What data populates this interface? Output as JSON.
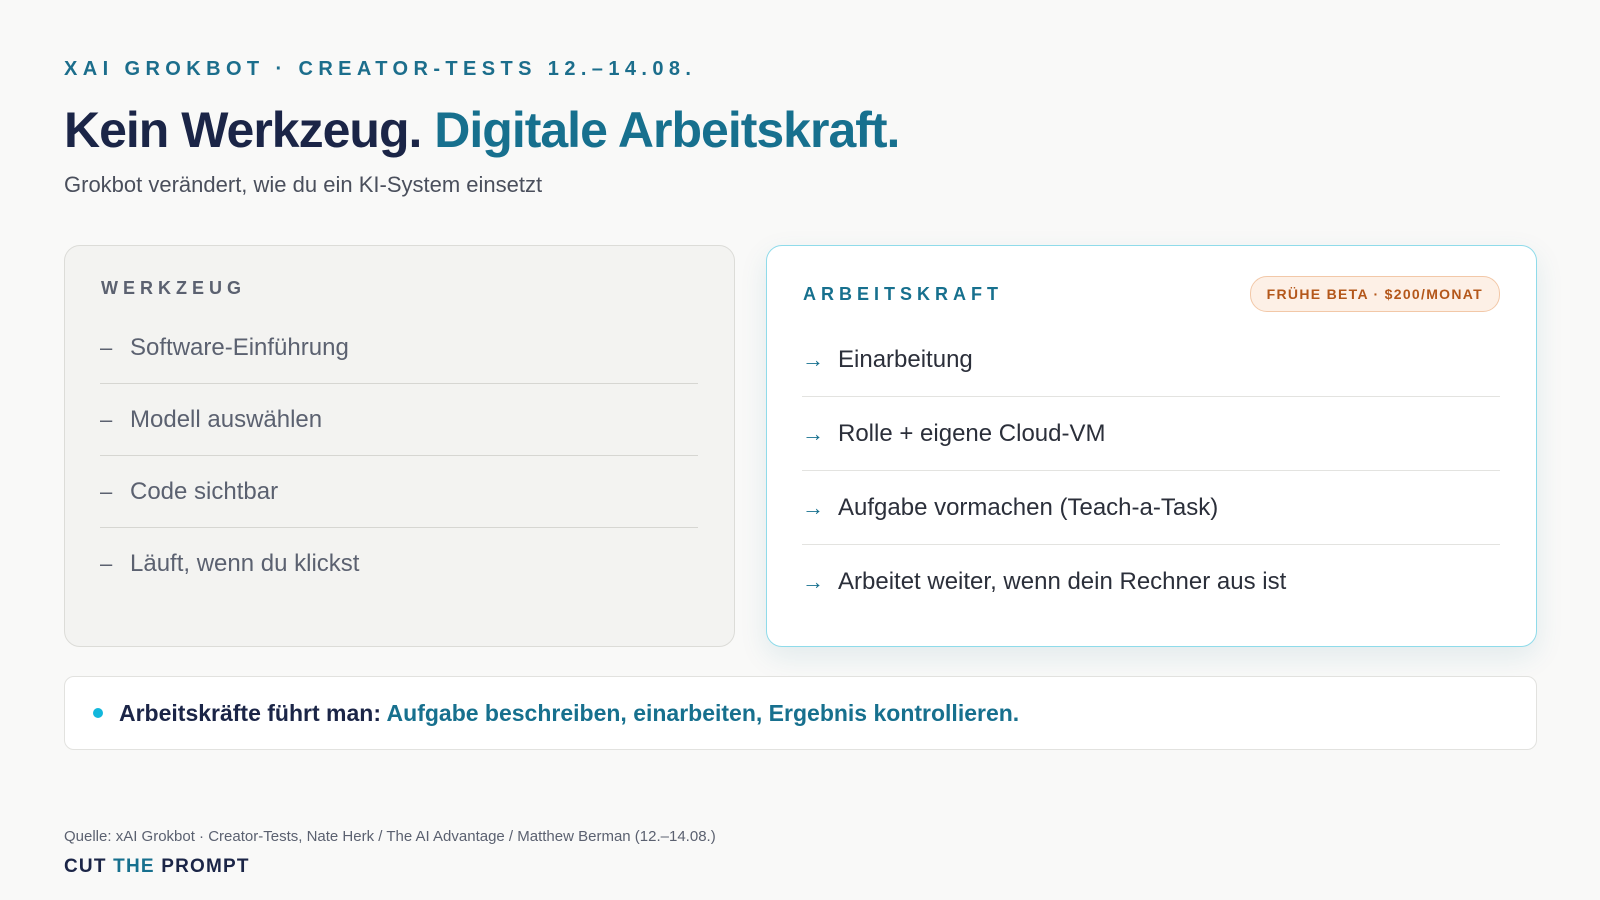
{
  "eyebrow": "XAI GROKBOT · CREATOR-TESTS 12.–14.08.",
  "headline": {
    "part1": "Kein Werkzeug. ",
    "part2": "Digitale Arbeitskraft."
  },
  "subtitle": "Grokbot verändert, wie du ein KI-System einsetzt",
  "tool_card": {
    "label": "WERKZEUG",
    "marker": "–",
    "items": [
      "Software-Einführung",
      "Modell auswählen",
      "Code sichtbar",
      "Läuft, wenn du klickst"
    ]
  },
  "work_card": {
    "label": "ARBEITSKRAFT",
    "badge": "FRÜHE BETA · $200/MONAT",
    "marker": "→",
    "items": [
      "Einarbeitung",
      "Rolle + eigene Cloud-VM",
      "Aufgabe vormachen (Teach-a-Task)",
      "Arbeitet weiter, wenn dein Rechner aus ist"
    ]
  },
  "takeaway": {
    "lead": "Arbeitskräfte führt man: ",
    "accent": "Aufgabe beschreiben, einarbeiten, Ergebnis kontrollieren."
  },
  "footer": {
    "source": "Quelle: xAI Grokbot · Creator-Tests, Nate Herk / The AI Advantage / Matthew Berman (12.–14.08.)",
    "brand_part1": "CUT ",
    "brand_part2": "THE",
    "brand_part3": " PROMPT"
  },
  "colors": {
    "background": "#f9f9f8",
    "navy": "#1b2547",
    "teal": "#17708e",
    "cyan_dot": "#12b7dc",
    "badge_text": "#b4571a",
    "badge_bg": "#fdf0e6"
  }
}
